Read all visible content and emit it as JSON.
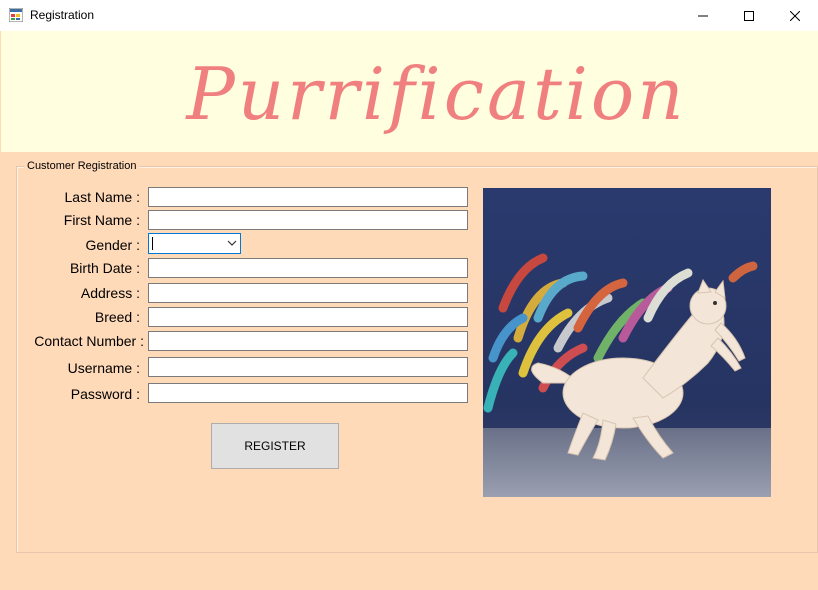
{
  "window": {
    "title": "Registration",
    "controls": [
      "minimize-icon",
      "maximize-icon",
      "close-icon"
    ]
  },
  "banner": {
    "text": "Purrification"
  },
  "group": {
    "label": "Customer Registration"
  },
  "form": {
    "last_name_label": "Last Name :",
    "first_name_label": "First Name :",
    "gender_label": "Gender :",
    "birth_date_label": "Birth Date :",
    "address_label": "Address :",
    "breed_label": "Breed :",
    "contact_label": "Contact Number :",
    "username_label": "Username :",
    "password_label": "Password :",
    "last_name_value": "",
    "first_name_value": "",
    "gender_value": "",
    "birth_date_value": "",
    "address_value": "",
    "breed_value": "",
    "contact_value": "",
    "username_value": "",
    "password_value": ""
  },
  "register_button": "REGISTER",
  "colors": {
    "background": "#ffdab9",
    "banner_background": "#ffffe0",
    "banner_text": "#f08080"
  }
}
